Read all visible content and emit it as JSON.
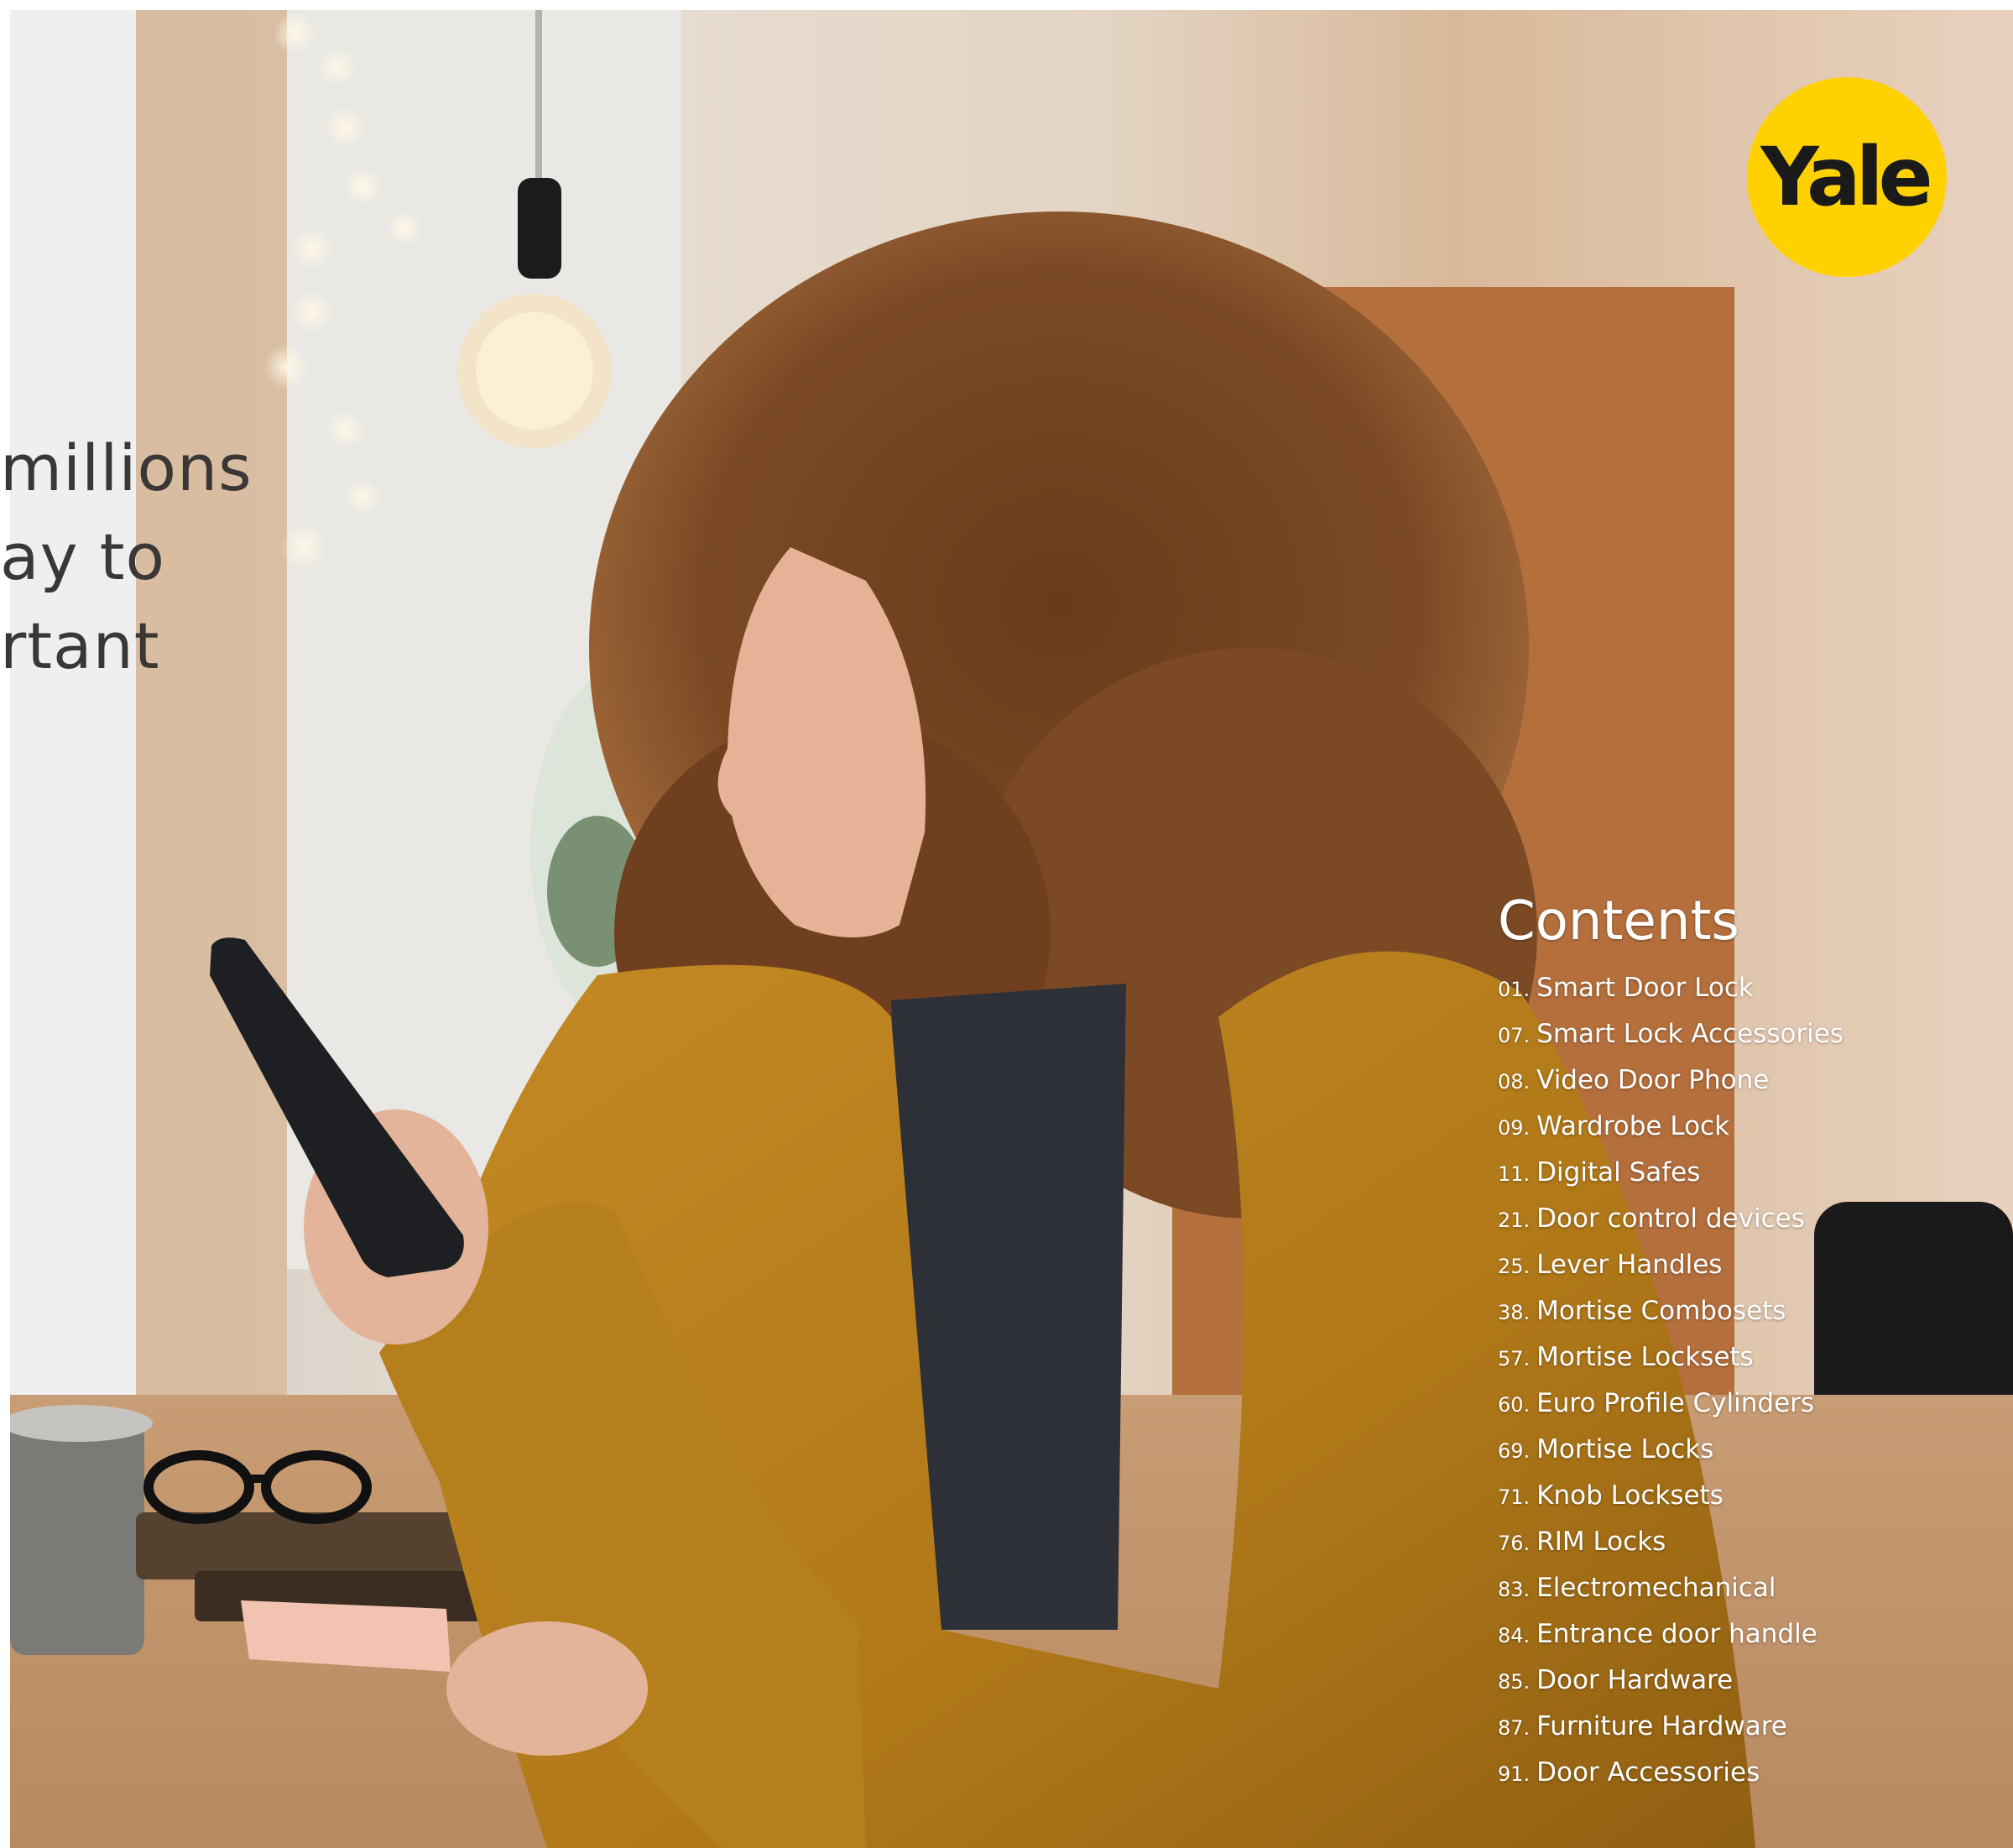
{
  "headline": {
    "lines": [
      "millions",
      "ay to",
      "rtant"
    ]
  },
  "logo": {
    "text": "Yale",
    "color": "#ffd100"
  },
  "contents": {
    "title": "Contents",
    "items": [
      {
        "num": "01.",
        "label": "Smart Door Lock"
      },
      {
        "num": "07.",
        "label": "Smart Lock Accessories"
      },
      {
        "num": "08.",
        "label": "Video Door Phone"
      },
      {
        "num": "09.",
        "label": "Wardrobe Lock"
      },
      {
        "num": "11.",
        "label": "Digital Safes"
      },
      {
        "num": "21.",
        "label": "Door control devices"
      },
      {
        "num": "25.",
        "label": "Lever Handles"
      },
      {
        "num": "38.",
        "label": "Mortise Combosets"
      },
      {
        "num": "57.",
        "label": "Mortise Locksets"
      },
      {
        "num": "60.",
        "label": "Euro Profile Cylinders"
      },
      {
        "num": "69.",
        "label": "Mortise Locks"
      },
      {
        "num": "71.",
        "label": "Knob Locksets"
      },
      {
        "num": "76.",
        "label": "RIM Locks"
      },
      {
        "num": "83.",
        "label": "Electromechanical"
      },
      {
        "num": "84.",
        "label": "Entrance door handle"
      },
      {
        "num": "85.",
        "label": "Door Hardware"
      },
      {
        "num": "87.",
        "label": "Furniture Hardware"
      },
      {
        "num": "91.",
        "label": "Door Accessories"
      }
    ]
  },
  "photo": {
    "subject": "woman-with-phone-photo"
  }
}
